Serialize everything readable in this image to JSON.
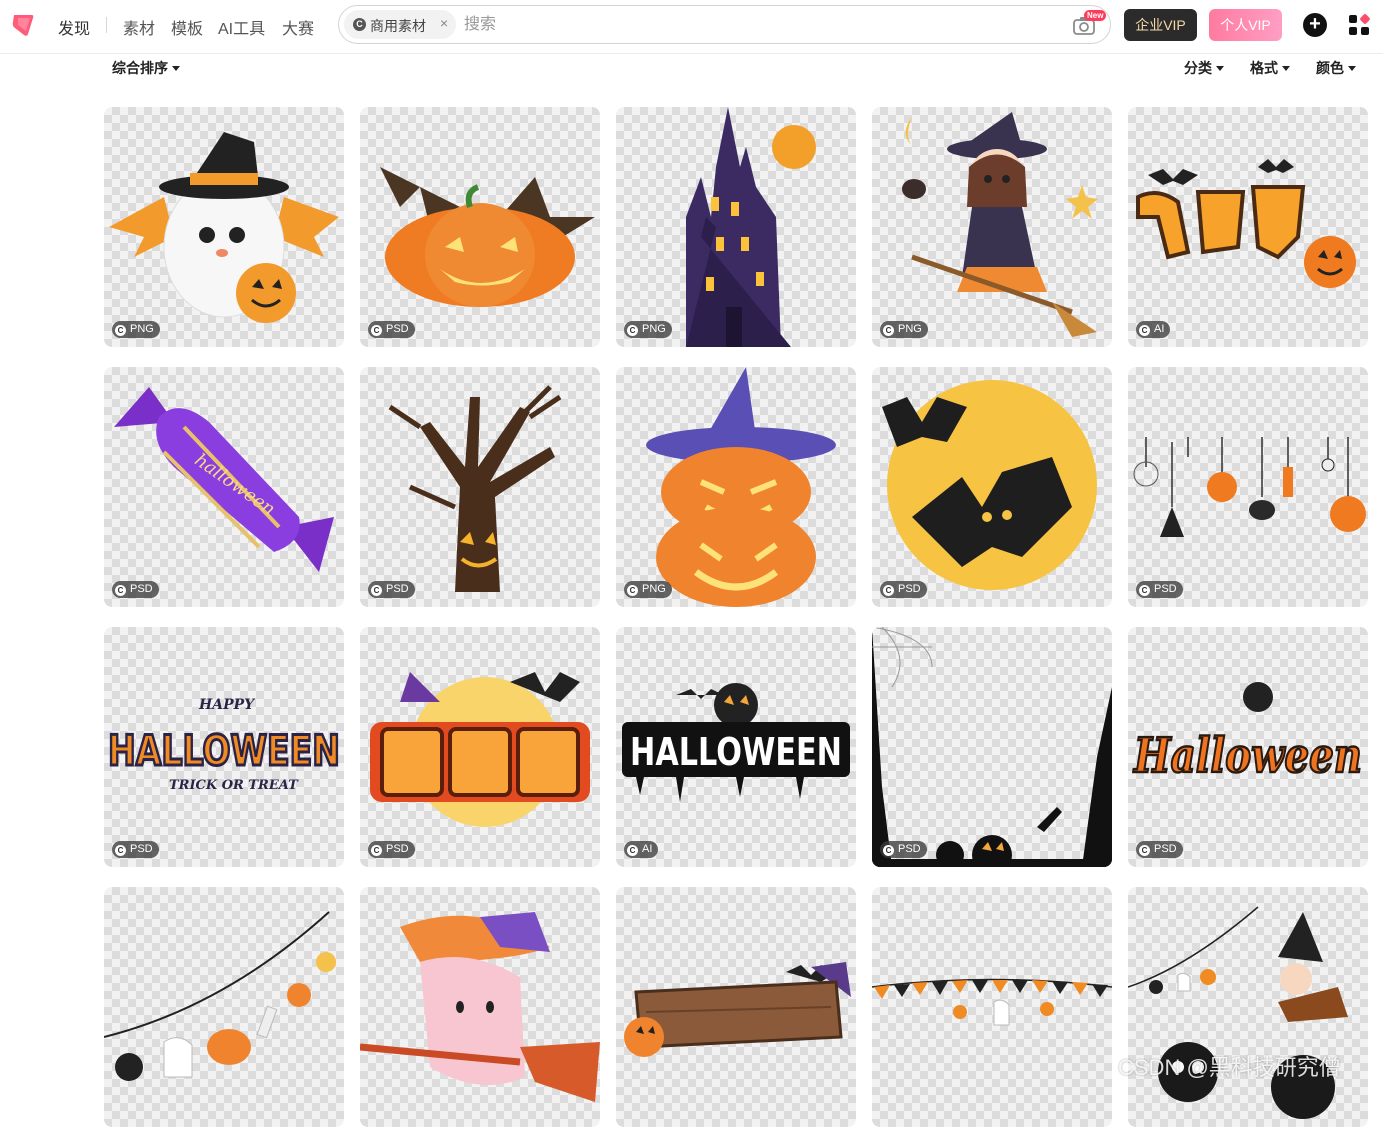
{
  "nav": {
    "discover": "发现",
    "items": [
      "素材",
      "模板",
      "AI工具",
      "大赛"
    ]
  },
  "search": {
    "chip_label": "商用素材",
    "chip_close": "×",
    "placeholder": "搜索",
    "new_badge": "New"
  },
  "actions": {
    "enterprise_vip": "企业VIP",
    "personal_vip": "个人VIP",
    "plus": "+"
  },
  "filters": {
    "sort": "综合排序",
    "category": "分类",
    "format": "格式",
    "color": "颜色"
  },
  "cards": [
    {
      "format": "PNG",
      "icon": "ghost-witch-hat"
    },
    {
      "format": "PSD",
      "icon": "bat-pumpkin"
    },
    {
      "format": "PNG",
      "icon": "haunted-castle"
    },
    {
      "format": "PNG",
      "icon": "witch-girl-broom"
    },
    {
      "format": "AI",
      "icon": "wanshengjie-text-bats"
    },
    {
      "format": "PSD",
      "icon": "purple-candy"
    },
    {
      "format": "PSD",
      "icon": "spooky-tree"
    },
    {
      "format": "PNG",
      "icon": "stacked-pumpkins-hat"
    },
    {
      "format": "PSD",
      "icon": "bats-moon"
    },
    {
      "format": "PSD",
      "icon": "hanging-decorations"
    },
    {
      "format": "PSD",
      "icon": "happy-halloween-lettering"
    },
    {
      "format": "PSD",
      "icon": "wanshengjie-title"
    },
    {
      "format": "AI",
      "icon": "halloween-drip-lettering"
    },
    {
      "format": "PSD",
      "icon": "spooky-frame"
    },
    {
      "format": "PSD",
      "icon": "halloween-orange-lettering"
    },
    {
      "format": "",
      "icon": "garland-spider-ghost"
    },
    {
      "format": "",
      "icon": "ghost-broom"
    },
    {
      "format": "",
      "icon": "wooden-sign"
    },
    {
      "format": "",
      "icon": "pennant-bunting"
    },
    {
      "format": "",
      "icon": "kid-witch-garland"
    }
  ],
  "card_letter": "C",
  "watermark": "CSDN @黑科技研究僧",
  "colors": {
    "brand": "#ff4d6d",
    "enterprise_bg": "#2b2b2b",
    "vip_pink": "#ff88aa"
  }
}
